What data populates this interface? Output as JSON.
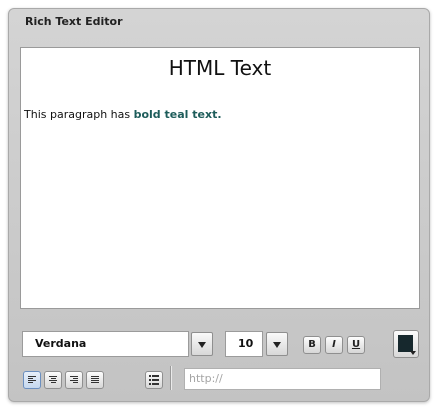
{
  "window": {
    "title": "Rich Text Editor"
  },
  "editor": {
    "heading": "HTML Text",
    "paragraph_prefix": "This paragraph has ",
    "paragraph_bold": "bold teal text.",
    "bold_color": "#1d5c5a"
  },
  "toolbar": {
    "font_family": "Verdana",
    "font_size": "10",
    "bold_label": "B",
    "italic_label": "I",
    "underline_label": "U",
    "text_color": "#16282d",
    "align_icons": [
      "align-left-icon",
      "align-center-icon",
      "align-right-icon",
      "align-justify-icon"
    ],
    "list_icon": "bullet-list-icon",
    "link_placeholder": "http://"
  }
}
